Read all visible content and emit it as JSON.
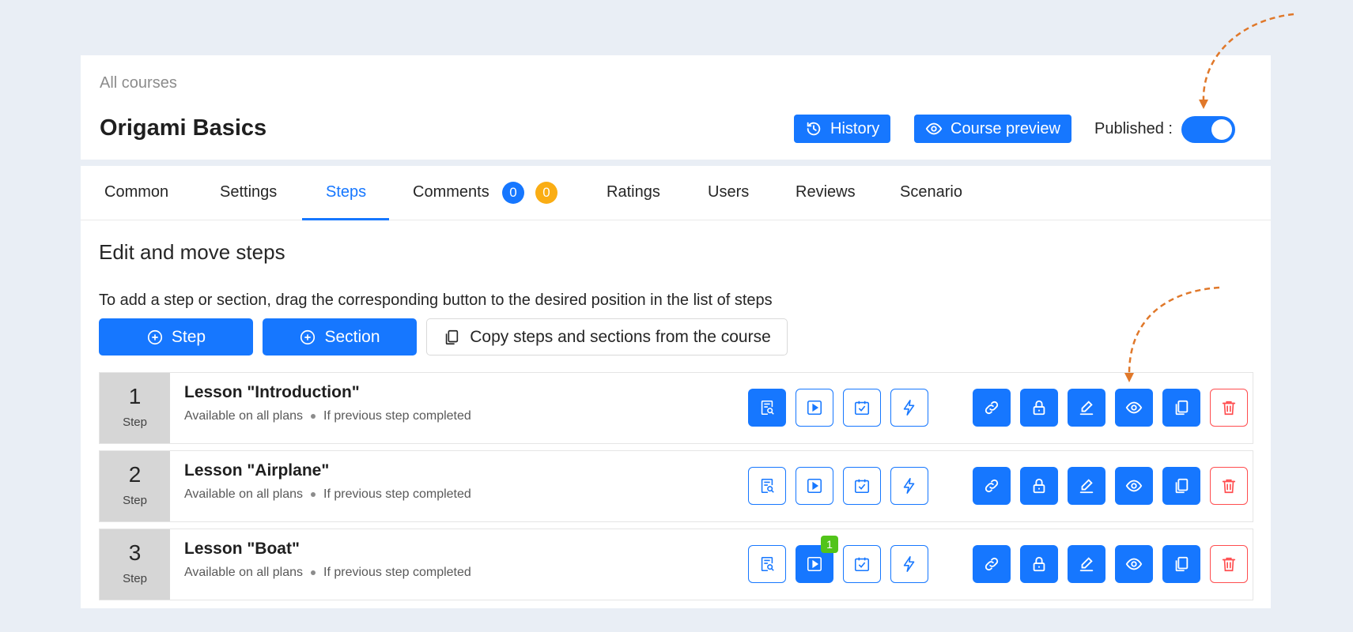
{
  "header": {
    "breadcrumb": "All courses",
    "title": "Origami Basics",
    "history_label": "History",
    "preview_label": "Course preview",
    "published_label": "Published",
    "published_sep": ":",
    "published_on": true
  },
  "tabs": [
    {
      "label": "Common"
    },
    {
      "label": "Settings"
    },
    {
      "label": "Steps",
      "active": true
    },
    {
      "label": "Comments",
      "badge_blue": "0",
      "badge_orange": "0"
    },
    {
      "label": "Ratings"
    },
    {
      "label": "Users"
    },
    {
      "label": "Reviews"
    },
    {
      "label": "Scenario"
    }
  ],
  "steps_panel": {
    "title": "Edit and move steps",
    "hint": "To add a step or section, drag the corresponding button to the desired position in the list of steps",
    "step_button": "Step",
    "section_button": "Section",
    "copy_button": "Copy steps and sections from the course"
  },
  "steps": [
    {
      "number": "1",
      "kind": "Step",
      "title": "Lesson \"Introduction\"",
      "availability": "Available on all plans",
      "condition": "If previous step completed",
      "content_badge": ""
    },
    {
      "number": "2",
      "kind": "Step",
      "title": "Lesson \"Airplane\"",
      "availability": "Available on all plans",
      "condition": "If previous step completed",
      "content_badge": ""
    },
    {
      "number": "3",
      "kind": "Step",
      "title": "Lesson \"Boat\"",
      "availability": "Available on all plans",
      "condition": "If previous step completed",
      "content_badge": "1"
    }
  ],
  "icons": {
    "step_content": [
      "document-search-icon",
      "play-icon",
      "calendar-check-icon",
      "lightning-icon"
    ],
    "step_actions": [
      "link-icon",
      "lock-icon",
      "edit-icon",
      "eye-icon",
      "copy-icon",
      "trash-icon"
    ]
  },
  "colors": {
    "primary": "#1677ff",
    "danger": "#ff4d4f",
    "success": "#52c41a",
    "warning": "#faad14",
    "annotation_arrow": "#e0782a"
  }
}
